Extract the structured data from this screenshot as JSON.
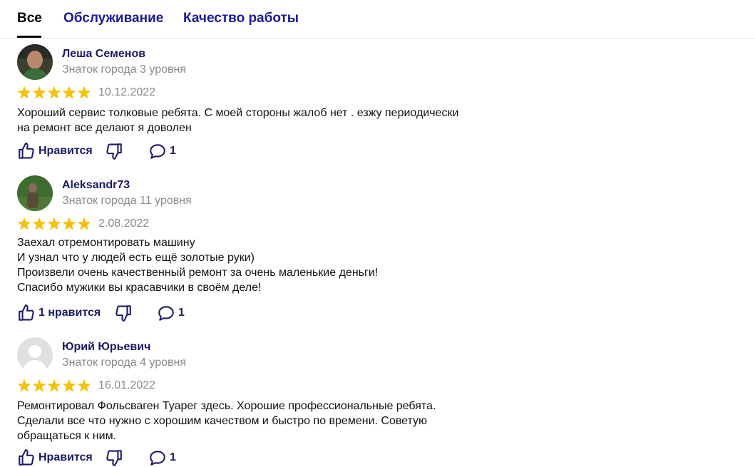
{
  "tabs": [
    {
      "label": "Все",
      "active": true
    },
    {
      "label": "Обслуживание",
      "active": false
    },
    {
      "label": "Качество работы",
      "active": false
    }
  ],
  "colors": {
    "star": "#f4c20d",
    "link": "#1a1a66",
    "muted": "#8a8a8a"
  },
  "reviews": [
    {
      "author": "Леша Семенов",
      "level": "Знаток города 3 уровня",
      "rating": 5,
      "date": "10.12.2022",
      "lines": [
        "Хороший сервис толковые ребята. С моей стороны жалоб нет . езжу периодически",
        "на ремонт все делают я доволен"
      ],
      "like_label": "Нравится",
      "comments": "1",
      "avatar": "photo"
    },
    {
      "author": "Aleksandr73",
      "level": "Знаток города 11 уровня",
      "rating": 5,
      "date": "2.08.2022",
      "lines": [
        "Заехал отремонтировать машину",
        "И узнал что у людей есть ещё золотые руки)",
        "Произвели очень качественный ремонт за очень маленькие деньги!",
        "Спасибо мужики вы красавчики в своём деле!"
      ],
      "like_label": "1 нравится",
      "comments": "1",
      "avatar": "photo"
    },
    {
      "author": "Юрий Юрьевич",
      "level": "Знаток города 4 уровня",
      "rating": 5,
      "date": "16.01.2022",
      "lines": [
        "Ремонтировал Фольсваген Туарег здесь. Хорошие профессиональные ребята.",
        "Сделали все что нужно с хорошим качеством и быстро по времени. Советую",
        "обращаться к ним."
      ],
      "like_label": "Нравится",
      "comments": "1",
      "avatar": "placeholder"
    }
  ]
}
